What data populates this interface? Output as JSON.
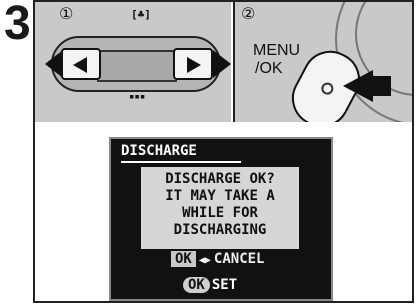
{
  "step": "3",
  "panel_left": {
    "callout": "①",
    "dial_top_icon": "[♣]",
    "dial_bottom_icon": "▪▪▪",
    "left_button_icon": "left-triangle-icon",
    "right_button_icon": "right-triangle-icon"
  },
  "panel_right": {
    "callout": "②",
    "button_label_line1": "MENU",
    "button_label_line2": "/OK"
  },
  "screen": {
    "title": "DISCHARGE",
    "message_lines": [
      "DISCHARGE OK?",
      "IT MAY TAKE A",
      "WHILE FOR",
      "DISCHARGING"
    ],
    "option_ok": "OK",
    "option_arrows": "◀▶",
    "option_cancel": "CANCEL",
    "set_ok": "OK",
    "set_label": "SET"
  }
}
